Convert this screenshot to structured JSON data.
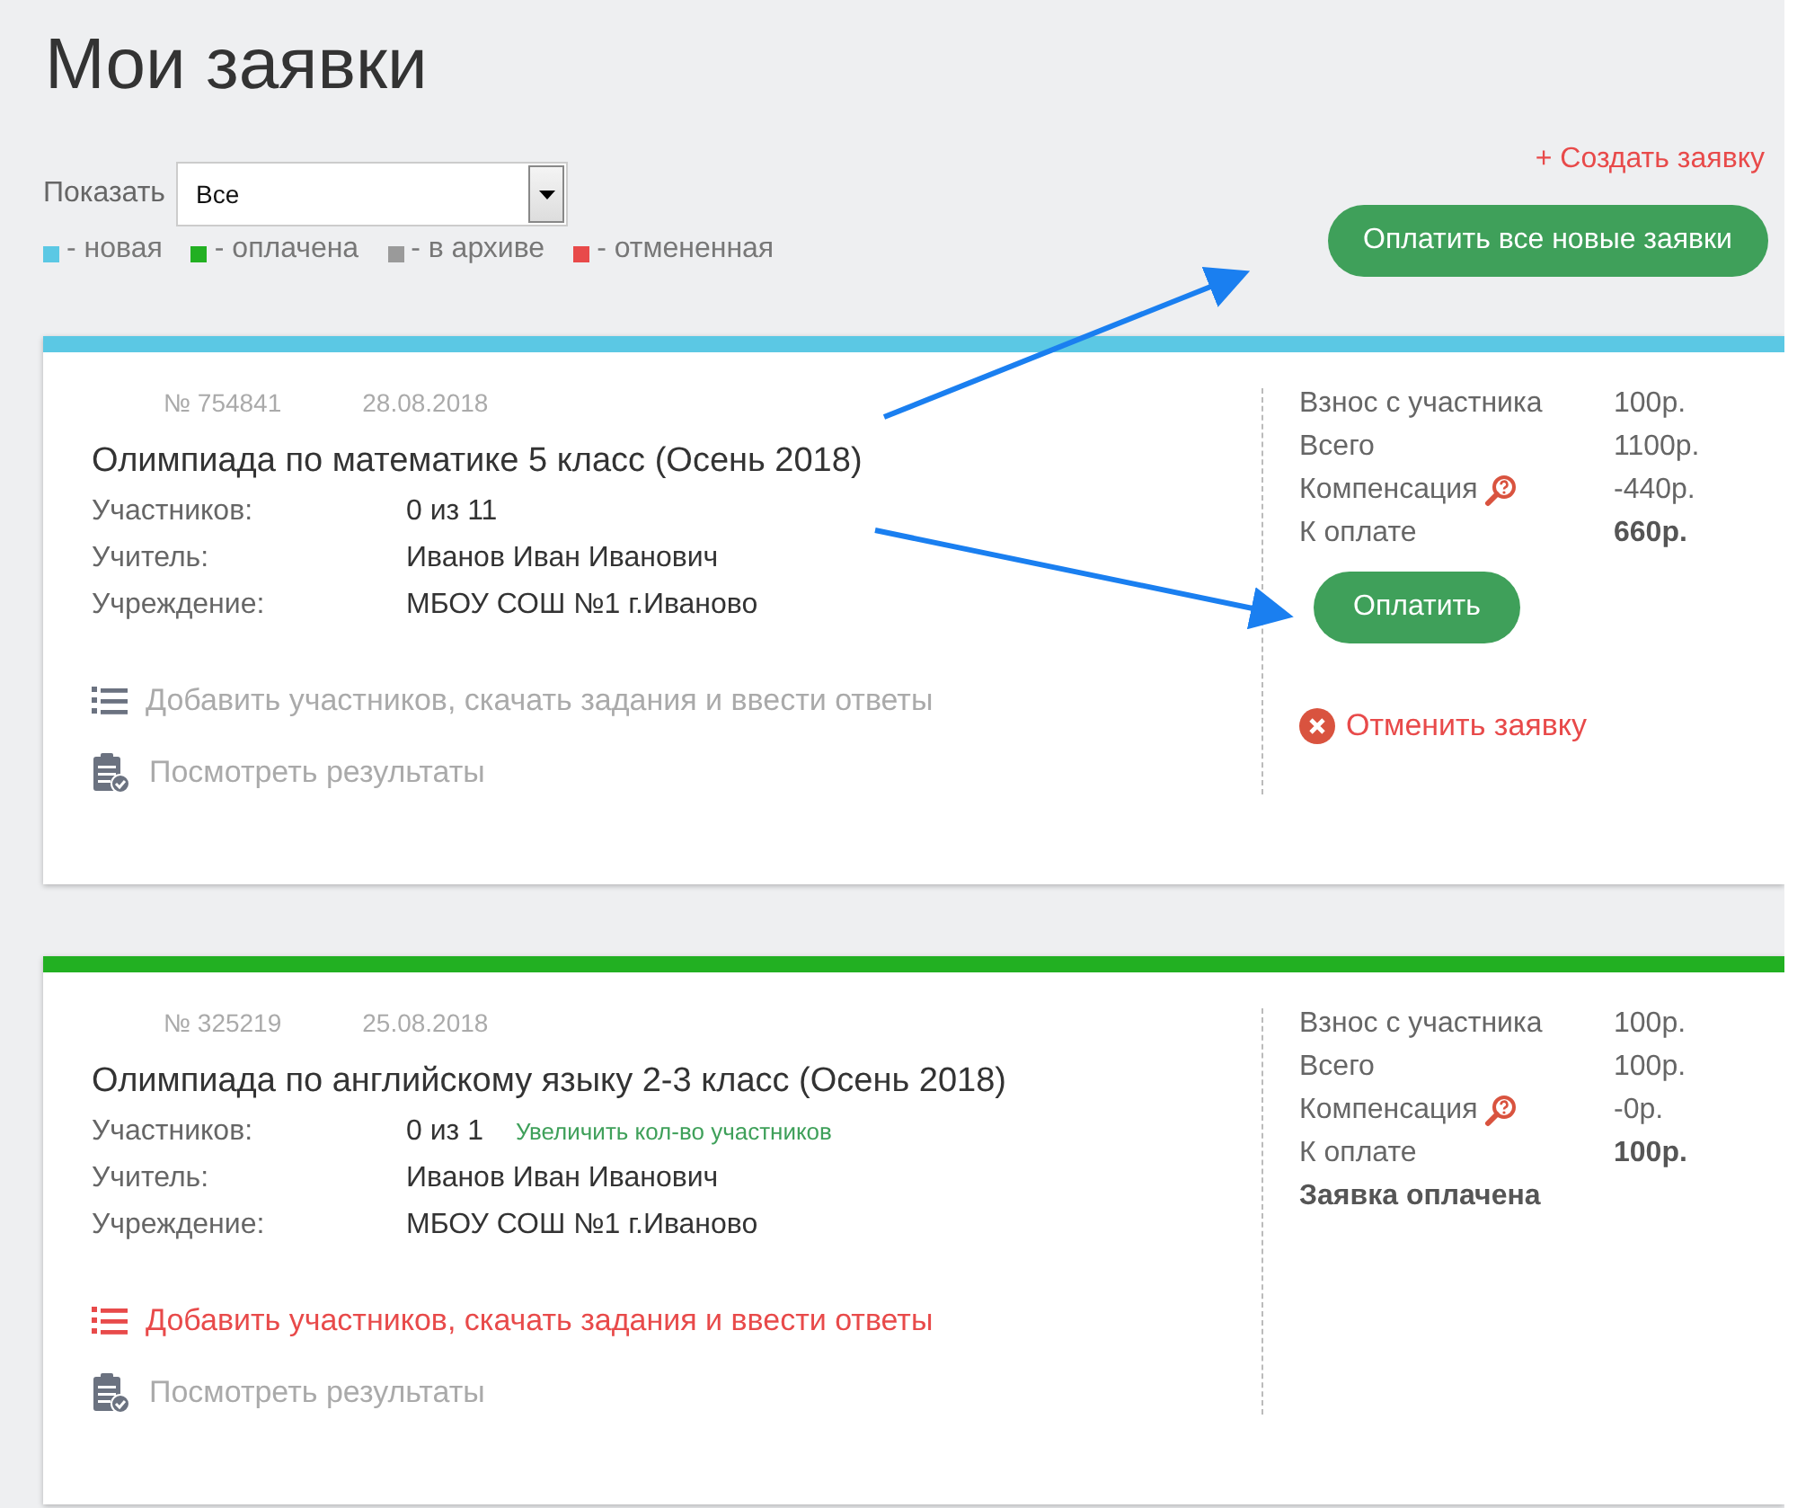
{
  "page": {
    "title": "Мои заявки"
  },
  "filter": {
    "label": "Показать",
    "value": "Все"
  },
  "legend": [
    {
      "label": "- новая",
      "color": "#5bc8e4"
    },
    {
      "label": "- оплачена",
      "color": "#22b022"
    },
    {
      "label": "- в архиве",
      "color": "#9a9a9a"
    },
    {
      "label": "- отмененная",
      "color": "#e84a4a"
    }
  ],
  "create_link": "+ Создать заявку",
  "pay_all_button": "Оплатить все новые заявки",
  "applications": [
    {
      "number": "№ 754841",
      "date": "28.08.2018",
      "color": "#5bc8e4",
      "title": "Олимпиада по математике 5 класс (Осень 2018)",
      "fields": [
        {
          "label": "Участников:",
          "value": "0 из 11"
        },
        {
          "label": "Учитель:",
          "value": "Иванов Иван Иванович"
        },
        {
          "label": "Учреждение:",
          "value": "МБОУ СОШ №1 г.Иваново"
        }
      ],
      "actions": [
        {
          "kind": "list",
          "label": "Добавить участников, скачать задания и ввести ответы",
          "highlighted": false
        },
        {
          "kind": "results",
          "label": "Посмотреть результаты",
          "highlighted": false
        }
      ],
      "summary": [
        {
          "label": "Взнос с участника",
          "value": "100р."
        },
        {
          "label": "Всего",
          "value": "1100р."
        },
        {
          "label": "Компенсация",
          "value": "-440р.",
          "help": true
        },
        {
          "label": "К оплате",
          "value": "660р.",
          "bold": true
        }
      ],
      "pay_button": "Оплатить",
      "cancel_link": "Отменить заявку"
    },
    {
      "number": "№ 325219",
      "date": "25.08.2018",
      "color": "#22b022",
      "title": "Олимпиада по английскому языку 2-3 класс (Осень 2018)",
      "fields": [
        {
          "label": "Участников:",
          "value": "0 из 1",
          "link": "Увеличить кол-во участников"
        },
        {
          "label": "Учитель:",
          "value": "Иванов Иван Иванович"
        },
        {
          "label": "Учреждение:",
          "value": "МБОУ СОШ №1 г.Иваново"
        }
      ],
      "actions": [
        {
          "kind": "list",
          "label": "Добавить участников, скачать задания и ввести ответы",
          "highlighted": true
        },
        {
          "kind": "results",
          "label": "Посмотреть результаты",
          "highlighted": false
        }
      ],
      "summary": [
        {
          "label": "Взнос с участника",
          "value": "100р."
        },
        {
          "label": "Всего",
          "value": "100р."
        },
        {
          "label": "Компенсация",
          "value": "-0р.",
          "help": true
        },
        {
          "label": "К оплате",
          "value": "100р.",
          "bold": true
        }
      ],
      "status_text": "Заявка оплачена"
    }
  ]
}
